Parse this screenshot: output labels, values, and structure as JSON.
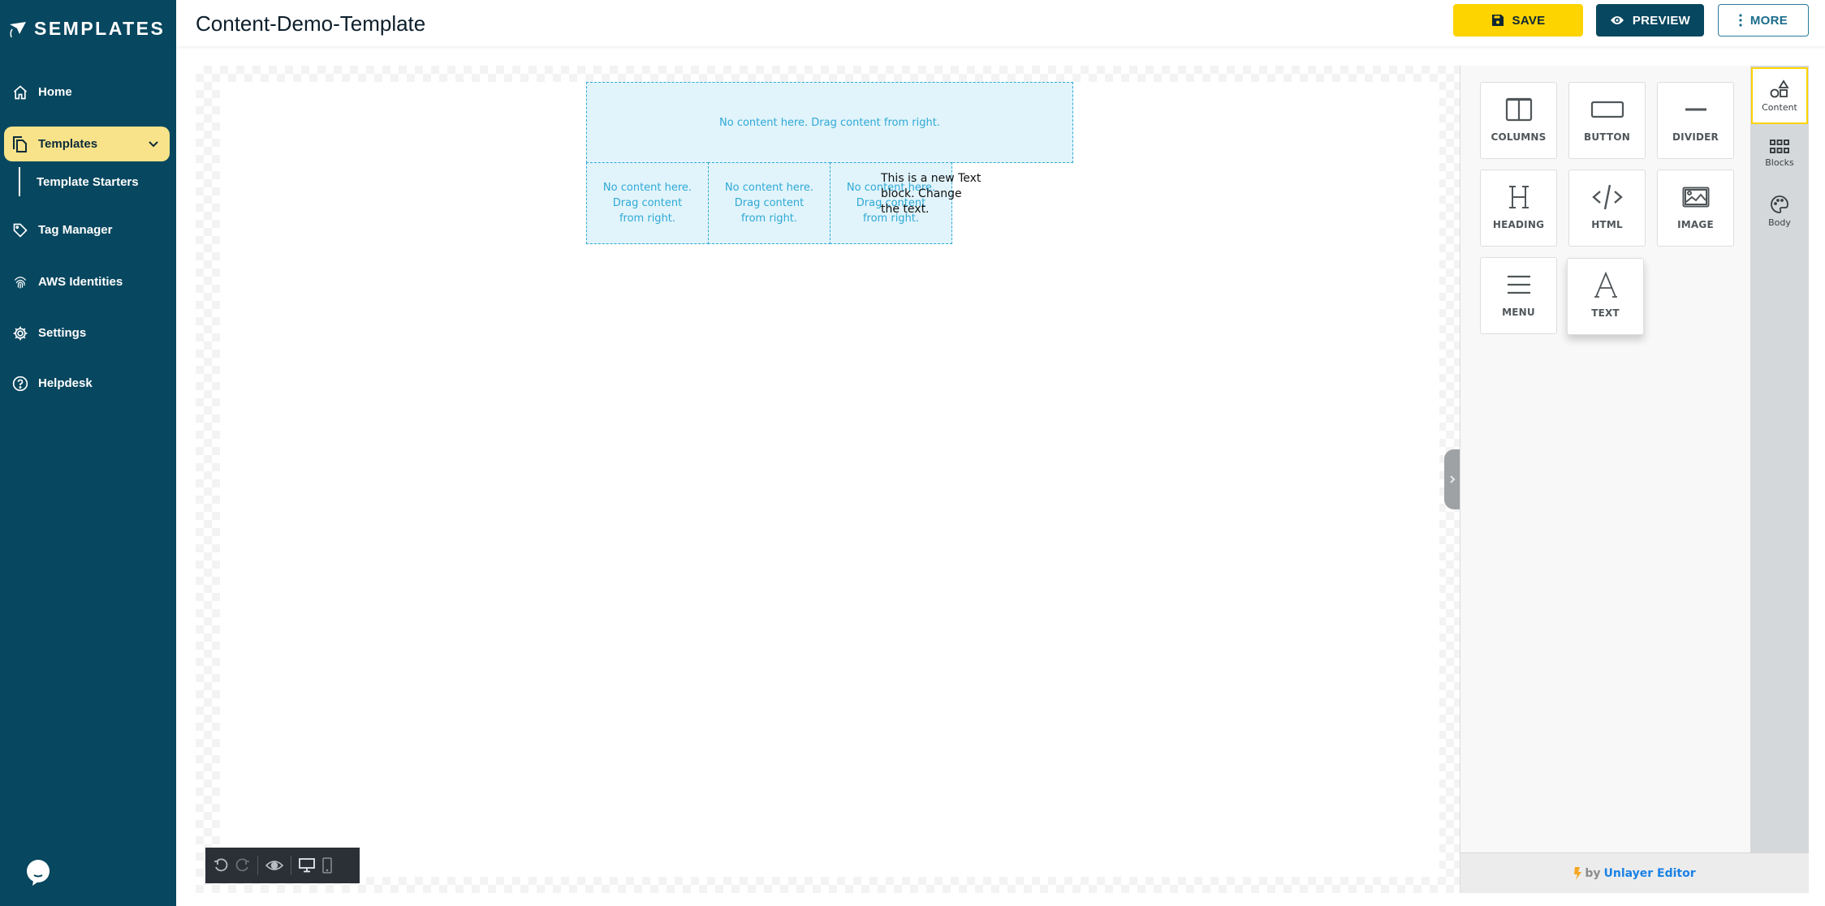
{
  "app": {
    "brand": "SEMPLATES",
    "page_title": "Content-Demo-Template"
  },
  "sidebar": {
    "items": [
      {
        "label": "Home",
        "icon": "home-icon"
      },
      {
        "label": "Templates",
        "icon": "copy-icon",
        "active": true,
        "expanded": true
      },
      {
        "label": "Template Starters",
        "sub": true
      },
      {
        "label": "Tag Manager",
        "icon": "tag-icon"
      },
      {
        "label": "AWS Identities",
        "icon": "fingerprint-icon"
      },
      {
        "label": "Settings",
        "icon": "gear-icon"
      },
      {
        "label": "Helpdesk",
        "icon": "help-circle-icon"
      }
    ],
    "chat_icon": "chat-bubble-icon"
  },
  "header": {
    "save_label": "SAVE",
    "preview_label": "PREVIEW",
    "more_label": "MORE"
  },
  "canvas": {
    "empty_full_row": "No content here. Drag content from right.",
    "empty_columns": [
      "No content here. Drag content from right.",
      "No content here. Drag content from right.",
      "No content here. Drag content from right."
    ],
    "text_block": "This is a new Text block. Change the text."
  },
  "toolbar": {
    "items": [
      "undo-icon",
      "redo-icon",
      "preview-eye-icon",
      "desktop-icon",
      "mobile-icon"
    ]
  },
  "panel": {
    "tiles": [
      {
        "label": "COLUMNS",
        "icon": "columns-icon"
      },
      {
        "label": "BUTTON",
        "icon": "button-icon"
      },
      {
        "label": "DIVIDER",
        "icon": "divider-icon"
      },
      {
        "label": "HEADING",
        "icon": "heading-icon"
      },
      {
        "label": "HTML",
        "icon": "code-icon"
      },
      {
        "label": "IMAGE",
        "icon": "image-icon"
      },
      {
        "label": "MENU",
        "icon": "menu-icon"
      },
      {
        "label": "TEXT",
        "icon": "text-icon"
      }
    ],
    "tabs": [
      {
        "label": "Content",
        "icon": "shapes-icon",
        "active": true
      },
      {
        "label": "Blocks",
        "icon": "grid-icon"
      },
      {
        "label": "Body",
        "icon": "palette-icon"
      }
    ],
    "footer": {
      "by": "by",
      "link": "Unlayer Editor"
    }
  },
  "colors": {
    "sidebar_bg": "#07475f",
    "accent_yellow": "#fdd300",
    "active_nav": "#f8e38a",
    "drop_zone": "#2fa9d6",
    "link_blue": "#1a82e6"
  }
}
